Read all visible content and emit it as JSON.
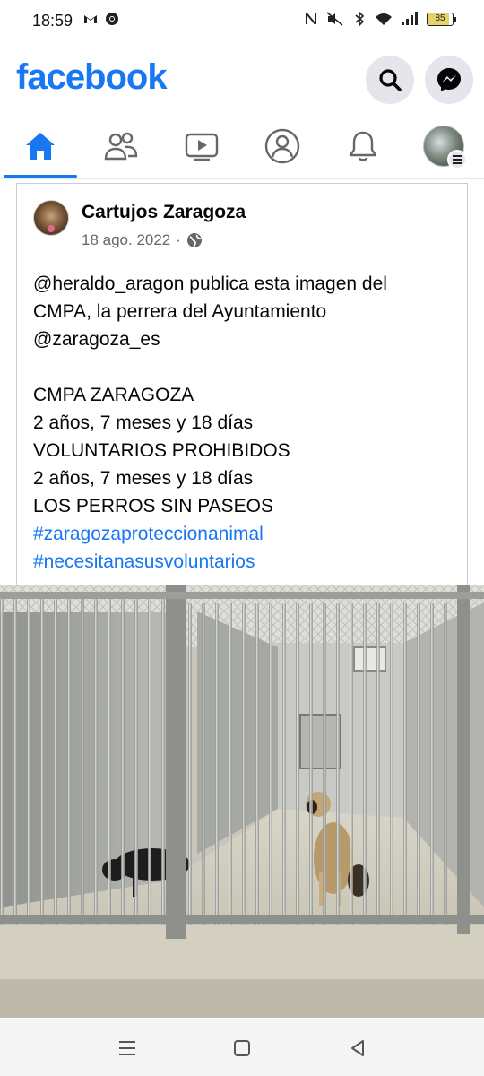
{
  "status_bar": {
    "time": "18:59",
    "battery": "85",
    "left_icons": [
      "gmail-icon",
      "chrome-icon"
    ],
    "right_icons": [
      "nfc-icon",
      "mute-icon",
      "bluetooth-icon",
      "wifi-icon",
      "signal-icon",
      "battery-icon"
    ]
  },
  "header": {
    "logo": "facebook",
    "brand_color": "#1877f2",
    "buttons": [
      "search-icon",
      "messenger-icon"
    ]
  },
  "tabs": [
    {
      "name": "home",
      "icon": "home-icon",
      "active": true
    },
    {
      "name": "friends",
      "icon": "friends-icon",
      "active": false
    },
    {
      "name": "watch",
      "icon": "video-icon",
      "active": false
    },
    {
      "name": "profile",
      "icon": "profile-icon",
      "active": false
    },
    {
      "name": "notifications",
      "icon": "bell-icon",
      "active": false
    },
    {
      "name": "menu",
      "icon": "menu-avatar",
      "active": false
    }
  ],
  "post": {
    "author": "Cartujos Zaragoza",
    "date": "18 ago. 2022",
    "separator": "·",
    "privacy_icon": "globe-icon",
    "text_lines": [
      "@heraldo_aragon publica esta imagen del",
      "CMPA, la perrera del Ayuntamiento",
      "@zaragoza_es",
      "",
      "CMPA ZARAGOZA",
      "2 años, 7 meses y 18 días",
      "VOLUNTARIOS PROHIBIDOS",
      "2 años, 7 meses y 18 días",
      "LOS PERROS SIN PASEOS"
    ],
    "hashtags": [
      "#zaragozaproteccionanimal",
      "#necesitanasusvoluntarios"
    ],
    "photo": "kennel-photo"
  },
  "nav_bar": [
    "recents-icon",
    "home-circle-icon",
    "back-icon"
  ]
}
